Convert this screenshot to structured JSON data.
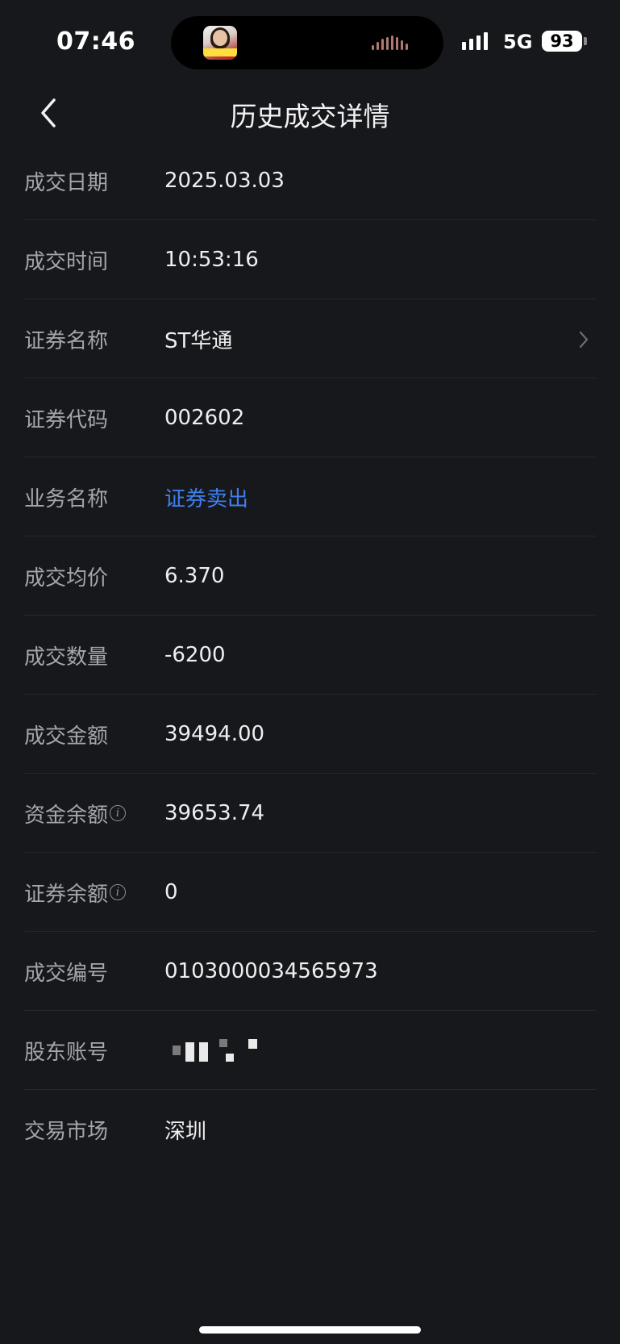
{
  "status": {
    "time": "07:46",
    "network": "5G",
    "battery": "93"
  },
  "nav": {
    "title": "历史成交详情"
  },
  "rows": [
    {
      "label": "成交日期",
      "value": "2025.03.03"
    },
    {
      "label": "成交时间",
      "value": "10:53:16"
    },
    {
      "label": "证券名称",
      "value": "ST华通"
    },
    {
      "label": "证券代码",
      "value": "002602"
    },
    {
      "label": "业务名称",
      "value": "证券卖出"
    },
    {
      "label": "成交均价",
      "value": "6.370"
    },
    {
      "label": "成交数量",
      "value": "-6200"
    },
    {
      "label": "成交金额",
      "value": "39494.00"
    },
    {
      "label": "资金余额",
      "value": "39653.74"
    },
    {
      "label": "证券余额",
      "value": "0"
    },
    {
      "label": "成交编号",
      "value": "0103000034565973"
    },
    {
      "label": "股东账号",
      "value": ""
    },
    {
      "label": "交易市场",
      "value": "深圳"
    }
  ],
  "colors": {
    "background": "#17181b",
    "link": "#3f7ff0",
    "label": "#a4a6ab",
    "value": "#eeeef0"
  },
  "icons": {
    "back": "chevron-left-icon",
    "row_arrow": "chevron-right-icon",
    "info": "info-icon"
  }
}
